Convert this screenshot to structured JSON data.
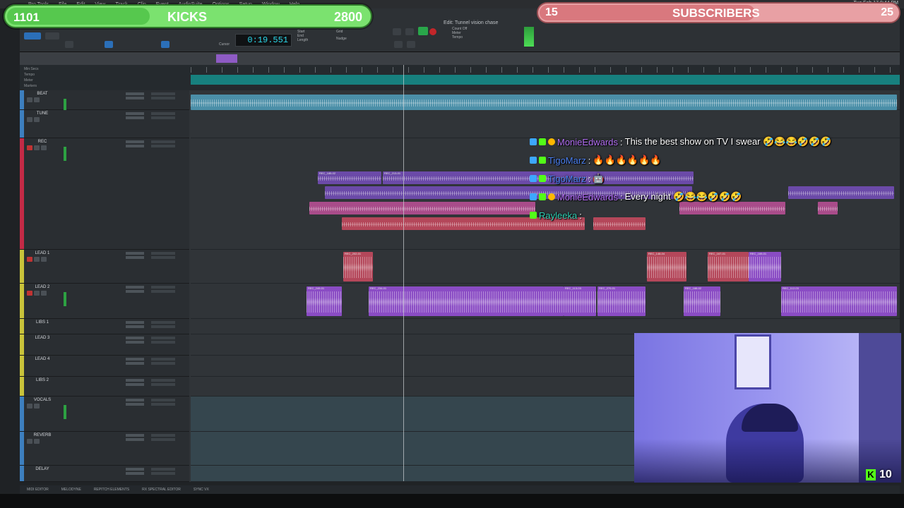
{
  "menubar": {
    "items": [
      "Pro Tools",
      "File",
      "Edit",
      "View",
      "Track",
      "Clip",
      "Event",
      "AudioSuite",
      "Options",
      "Setup",
      "Window",
      "Help"
    ],
    "clock": "Tue Feb 17 8:44 PM"
  },
  "toolbar": {
    "edit_title": "Edit: Tunnel vision chase",
    "counter": "0:19.551",
    "labels": [
      "Start",
      "End",
      "Length",
      "Cursor",
      "Grid",
      "Nudge",
      "Count Off",
      "Meter",
      "Tempo"
    ]
  },
  "ruler_names": [
    "Min:Secs",
    "Tempo",
    "Meter",
    "Markers"
  ],
  "tracks": [
    {
      "name": "BEAT",
      "color": "#3d7fbf"
    },
    {
      "name": "TUNE",
      "color": "#3d7fbf"
    },
    {
      "name": "REC",
      "color": "#c42a46"
    },
    {
      "name": "LEAD 1",
      "color": "#c9c33a"
    },
    {
      "name": "LEAD 2",
      "color": "#c9c33a"
    },
    {
      "name": "LIBS 1",
      "color": "#c9c33a"
    },
    {
      "name": "LEAD 3",
      "color": "#c9c33a"
    },
    {
      "name": "LEAD 4",
      "color": "#c9c33a"
    },
    {
      "name": "LIBS 2",
      "color": "#c9c33a"
    },
    {
      "name": "VOCALS",
      "color": "#3d7fbf"
    },
    {
      "name": "REVERB",
      "color": "#3d7fbf"
    },
    {
      "name": "DELAY",
      "color": "#3d7fbf"
    }
  ],
  "clip_labels": [
    "REC_185-02",
    "REC_213-01",
    "REC_208-01",
    "REC_202-01",
    "REC_148-04",
    "REC_167-01",
    "REC_169-01",
    "REC_249-01",
    "REC_234-01",
    "REC_113-03",
    "REC_270-01",
    "REC_188-02",
    "REC_112-03",
    "REC_381-01"
  ],
  "statusbar": [
    "MIDI EDITOR",
    "MELODYNE",
    "REPITCH ELEMENTS",
    "RX SPECTRAL EDITOR",
    "SYNC VX"
  ],
  "kicks_goal": {
    "current": "1101",
    "label": "KICKS",
    "goal": "2800",
    "progress": 0.393
  },
  "subscribers_goal": {
    "current": "15",
    "label": "SUBSCRIBERS",
    "goal": "25",
    "progress": 0.6
  },
  "chat": [
    {
      "user": "MonieEdwards",
      "text": "This the best show on TV I swear 🤣😂😂🤣🤣🤣",
      "color": "#b06cf0"
    },
    {
      "user": "TigoMarz",
      "text": "🔥🔥🔥🔥🔥🔥",
      "color": "#4a7ff0"
    },
    {
      "user": "TigoMarz",
      "text": "🤖",
      "color": "#4a7ff0"
    },
    {
      "user": "MonieEdwards",
      "text": "Every night 🤣😂😂🤣🤣🤣",
      "color": "#b06cf0"
    },
    {
      "user": "Rayleeka",
      "text": "",
      "color": "#2fd0b4"
    }
  ],
  "viewers": {
    "platform_icon": "K",
    "count": "10"
  }
}
